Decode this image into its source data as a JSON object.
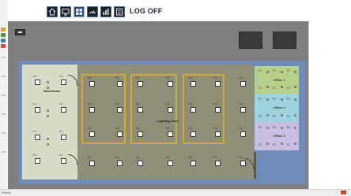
{
  "nav": {
    "buttons": [
      {
        "name": "home-icon"
      },
      {
        "name": "monitor-icon"
      },
      {
        "name": "layout-icon",
        "active": true
      },
      {
        "name": "gauge-icon"
      },
      {
        "name": "chart-icon"
      },
      {
        "name": "report-icon"
      }
    ],
    "logoff": "LOG OFF"
  },
  "colors": {
    "zone_top": "#b9d08a",
    "zone_mid": "#9fd3df",
    "zone_bot": "#c9bfe3",
    "floor": "#6f8db9",
    "highlight": "#d2a935"
  },
  "left_panel": {
    "label": "Warehouse"
  },
  "zones": [
    {
      "title": "Office 1",
      "tag": "TC"
    },
    {
      "title": "Office 2",
      "tag": "TC"
    },
    {
      "title": "Office 3",
      "tag": "TC"
    }
  ],
  "main_label": "Lighting Zone",
  "status": {
    "text": "Ready"
  },
  "lights": {
    "tag": "L1"
  }
}
